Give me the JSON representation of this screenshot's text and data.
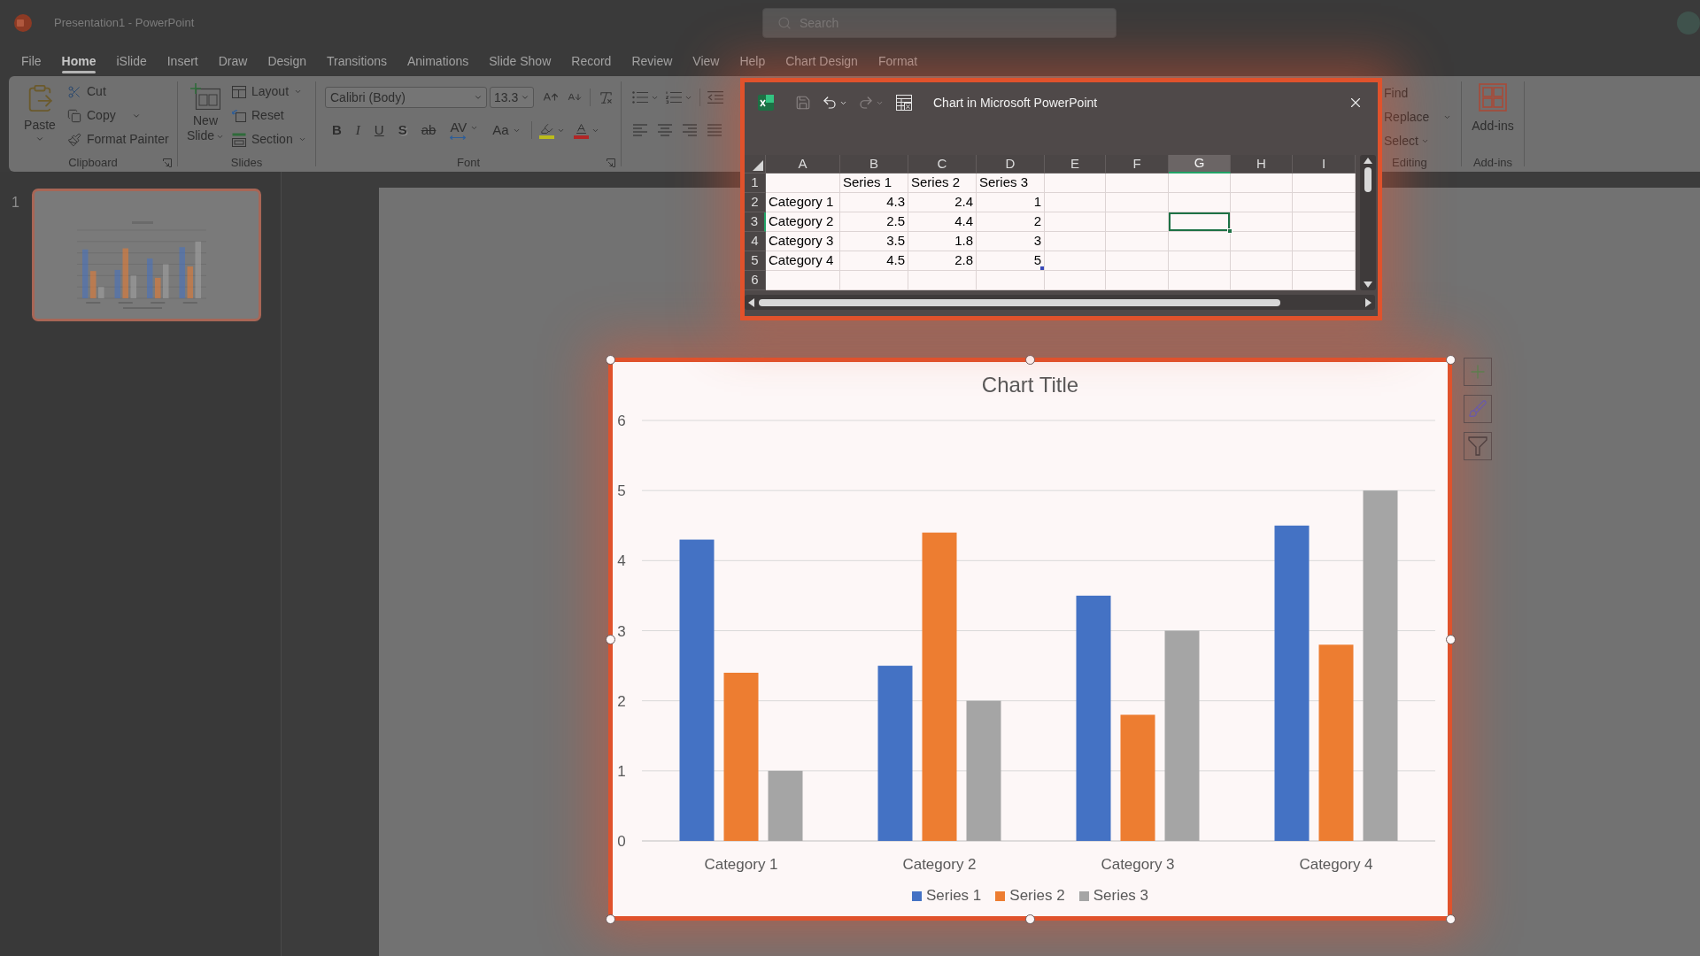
{
  "app": {
    "title": "Presentation1 - PowerPoint",
    "search": {
      "placeholder": "Search"
    }
  },
  "menu_tabs": [
    {
      "label": "File",
      "selected": false
    },
    {
      "label": "Home",
      "selected": true
    },
    {
      "label": "iSlide",
      "selected": false
    },
    {
      "label": "Insert",
      "selected": false
    },
    {
      "label": "Draw",
      "selected": false
    },
    {
      "label": "Design",
      "selected": false
    },
    {
      "label": "Transitions",
      "selected": false
    },
    {
      "label": "Animations",
      "selected": false
    },
    {
      "label": "Slide Show",
      "selected": false
    },
    {
      "label": "Record",
      "selected": false
    },
    {
      "label": "Review",
      "selected": false
    },
    {
      "label": "View",
      "selected": false
    },
    {
      "label": "Help",
      "selected": false
    },
    {
      "label": "Chart Design",
      "selected": false
    },
    {
      "label": "Format",
      "selected": false
    }
  ],
  "ribbon": {
    "clipboard": {
      "label": "Clipboard",
      "paste": "Paste",
      "cut": "Cut",
      "copy": "Copy",
      "format_painter": "Format Painter"
    },
    "slides": {
      "label": "Slides",
      "new_slide": "New Slide",
      "layout": "Layout",
      "reset": "Reset",
      "section": "Section"
    },
    "font": {
      "label": "Font",
      "font_name": "Calibri (Body)",
      "font_size": "13.3",
      "format_buttons": [
        {
          "kind": "bold",
          "label": "B"
        },
        {
          "kind": "italic",
          "label": "I"
        },
        {
          "kind": "underline",
          "label": "U"
        },
        {
          "kind": "shadow",
          "label": "S"
        },
        {
          "kind": "strikethrough",
          "label": "ab"
        },
        {
          "kind": "spacing",
          "label": "AV"
        },
        {
          "kind": "case",
          "label": "Aa"
        }
      ]
    },
    "editing": {
      "label": "Editing",
      "find": "Find",
      "replace": "Replace",
      "select": "Select"
    },
    "add_ins": {
      "label": "Add-ins",
      "button": "Add-ins"
    }
  },
  "slides_pane": {
    "slides": [
      {
        "number": "1",
        "selected": true
      }
    ]
  },
  "data_window": {
    "title": "Chart in Microsoft PowerPoint",
    "columns": [
      {
        "label": "A",
        "selected": false
      },
      {
        "label": "B",
        "selected": false
      },
      {
        "label": "C",
        "selected": false
      },
      {
        "label": "D",
        "selected": false
      },
      {
        "label": "E",
        "selected": false
      },
      {
        "label": "F",
        "selected": false
      },
      {
        "label": "G",
        "selected": true
      },
      {
        "label": "H",
        "selected": false
      },
      {
        "label": "I",
        "selected": false
      }
    ],
    "rows": [
      {
        "header": "1",
        "selected": false,
        "cells": [
          null,
          "Series 1",
          "Series 2",
          "Series 3"
        ]
      },
      {
        "header": "2",
        "selected": false,
        "cells": [
          "Category 1",
          "4.3",
          "2.4",
          "1"
        ]
      },
      {
        "header": "3",
        "selected": true,
        "cells": [
          "Category 2",
          "2.5",
          "4.4",
          "2"
        ]
      },
      {
        "header": "4",
        "selected": false,
        "cells": [
          "Category 3",
          "3.5",
          "1.8",
          "3"
        ]
      },
      {
        "header": "5",
        "selected": false,
        "cells": [
          "Category 4",
          "4.5",
          "2.8",
          "5"
        ]
      },
      {
        "header": "6",
        "selected": false
      }
    ]
  },
  "chart": {
    "chart_data": {
      "type": "bar",
      "title": "Chart Title",
      "categories": [
        "Category 1",
        "Category 2",
        "Category 3",
        "Category 4"
      ],
      "series": [
        {
          "name": "Series 1",
          "color": "#4472c4",
          "values": [
            4.3,
            2.5,
            3.5,
            4.5
          ]
        },
        {
          "name": "Series 2",
          "color": "#ed7d31",
          "values": [
            2.4,
            4.4,
            1.8,
            2.8
          ]
        },
        {
          "name": "Series 3",
          "color": "#a5a5a5",
          "values": [
            1,
            2,
            3,
            5
          ]
        }
      ],
      "ylim": [
        0,
        6
      ],
      "yticks": [
        {
          "value": 0,
          "label": "0"
        },
        {
          "value": 1,
          "label": "1"
        },
        {
          "value": 2,
          "label": "2"
        },
        {
          "value": 3,
          "label": "3"
        },
        {
          "value": 4,
          "label": "4"
        },
        {
          "value": 5,
          "label": "5"
        },
        {
          "value": 6,
          "label": "6"
        }
      ],
      "grid": true,
      "legend": true
    }
  }
}
